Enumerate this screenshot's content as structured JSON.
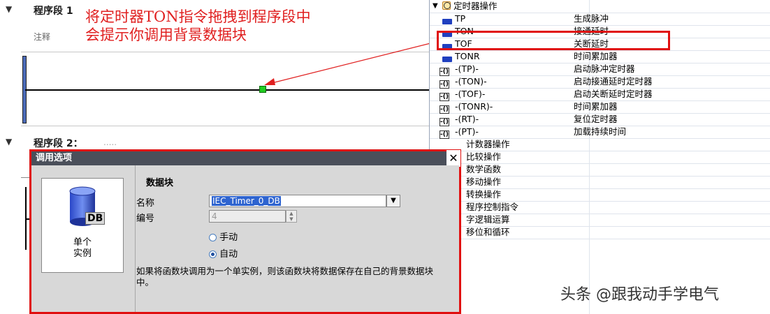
{
  "editor": {
    "segment1": {
      "label": "程序段 1",
      "comment": "注释"
    },
    "segment2": {
      "label": "程序段 2：",
      "dots": "....."
    },
    "annotation": {
      "line1": "将定时器TON指令拖拽到程序段中",
      "line2": "会提示你调用背景数据块"
    }
  },
  "tree": {
    "group": "定时器操作",
    "items": [
      {
        "name": "TP",
        "desc": "生成脉冲",
        "icon": "function-block-icon"
      },
      {
        "name": "TON",
        "desc": "接通延时",
        "icon": "function-block-icon",
        "highlighted": true
      },
      {
        "name": "TOF",
        "desc": "关断延时",
        "icon": "function-block-icon"
      },
      {
        "name": "TONR",
        "desc": "时间累加器",
        "icon": "function-block-icon"
      },
      {
        "name": "-(TP)-",
        "desc": "启动脉冲定时器",
        "icon": "coil-icon"
      },
      {
        "name": "-(TON)-",
        "desc": "启动接通延时定时器",
        "icon": "coil-icon"
      },
      {
        "name": "-(TOF)-",
        "desc": "启动关断延时定时器",
        "icon": "coil-icon"
      },
      {
        "name": "-(TONR)-",
        "desc": "时间累加器",
        "icon": "coil-icon"
      },
      {
        "name": "-(RT)-",
        "desc": "复位定时器",
        "icon": "coil-icon"
      },
      {
        "name": "-(PT)-",
        "desc": "加载持续时间",
        "icon": "coil-icon"
      }
    ],
    "categories": [
      "计数器操作",
      "比较操作",
      "数学函数",
      "移动操作",
      "转换操作",
      "程序控制指令",
      "字逻辑运算",
      "移位和循环"
    ]
  },
  "dialog": {
    "title": "调用选项",
    "close": "✕",
    "instance_label_line1": "单个",
    "instance_label_line2": "实例",
    "db_icon_text": "DB",
    "section": "数据块",
    "name_label": "名称",
    "name_value": "IEC_Timer_0_DB",
    "number_label": "编号",
    "number_value": "4",
    "manual_label": "手动",
    "auto_label": "自动",
    "auto_selected": true,
    "info": "如果将函数块调用为一个单实例，则该函数块将数据保存在自己的背景数据块中。"
  },
  "watermark": "头条 @跟我动手学电气",
  "colors": {
    "highlight": "#e01010",
    "accent": "#1f3fbf",
    "annotation": "#e02020",
    "contact_green": "#22cc22"
  }
}
